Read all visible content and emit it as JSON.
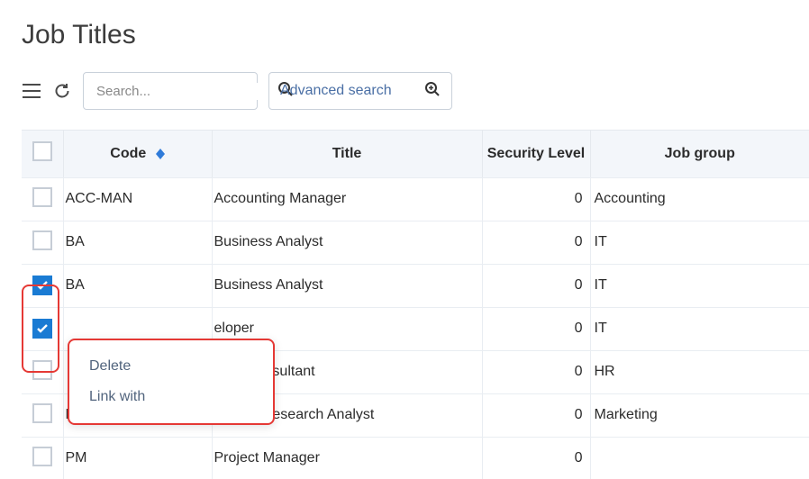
{
  "page": {
    "title": "Job Titles"
  },
  "toolbar": {
    "search_placeholder": "Search...",
    "advanced_search_label": "Advanced search"
  },
  "table": {
    "headers": {
      "code": "Code",
      "title": "Title",
      "security": "Security Level",
      "group": "Job group"
    },
    "rows": [
      {
        "checked": false,
        "code": "ACC-MAN",
        "title": "Accounting Manager",
        "security": 0,
        "group": "Accounting"
      },
      {
        "checked": false,
        "code": "BA",
        "title": "Business Analyst",
        "security": 0,
        "group": "IT"
      },
      {
        "checked": true,
        "code": "BA",
        "title": "Business Analyst",
        "security": 0,
        "group": "IT"
      },
      {
        "checked": true,
        "code": "",
        "title": "eloper",
        "security": 0,
        "group": "IT"
      },
      {
        "checked": false,
        "code": "",
        "title": "urce Consultant",
        "security": 0,
        "group": "HR"
      },
      {
        "checked": false,
        "code": "MRES-AN",
        "title": "Market Research Analyst",
        "security": 0,
        "group": "Marketing"
      },
      {
        "checked": false,
        "code": "PM",
        "title": "Project Manager",
        "security": 0,
        "group": ""
      }
    ]
  },
  "context_menu": {
    "items": [
      "Delete",
      "Link with"
    ]
  }
}
